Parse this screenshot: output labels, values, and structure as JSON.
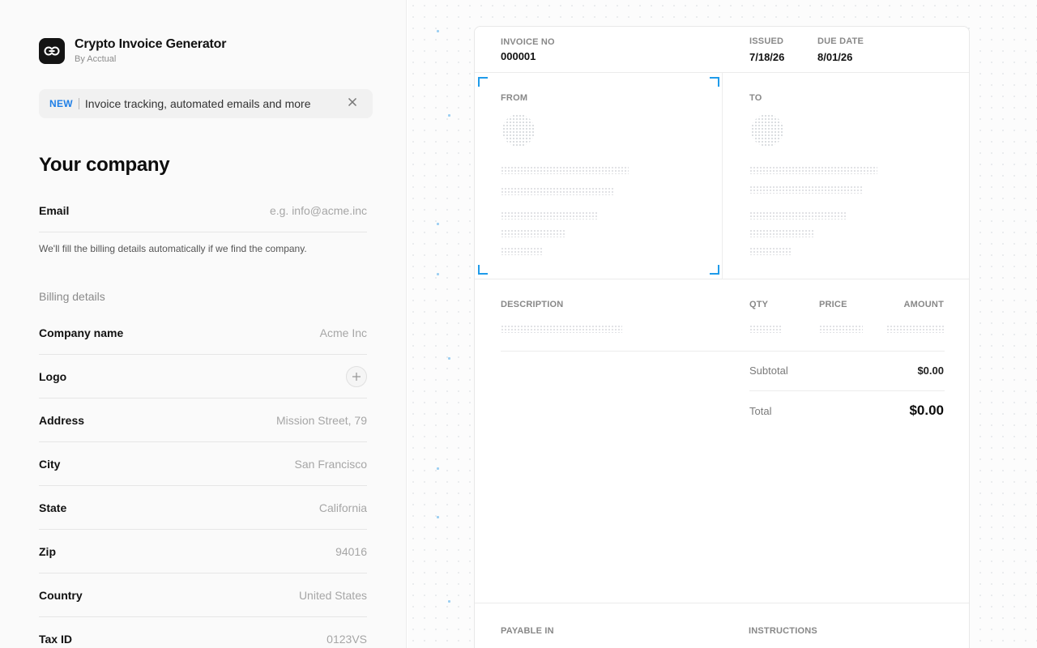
{
  "app": {
    "title": "Crypto Invoice Generator",
    "by": "By Acctual"
  },
  "promo": {
    "tag": "NEW",
    "text": "Invoice tracking, automated emails and more"
  },
  "company_section": {
    "title": "Your company",
    "email": {
      "label": "Email",
      "placeholder": "e.g. info@acme.inc",
      "value": ""
    },
    "hint": "We'll fill the billing details automatically if we find the company.",
    "billing_heading": "Billing details",
    "fields": {
      "company_name": {
        "label": "Company name",
        "placeholder": "Acme Inc"
      },
      "logo": {
        "label": "Logo"
      },
      "address": {
        "label": "Address",
        "placeholder": "Mission Street, 79"
      },
      "city": {
        "label": "City",
        "placeholder": "San Francisco"
      },
      "state": {
        "label": "State",
        "placeholder": "California"
      },
      "zip": {
        "label": "Zip",
        "placeholder": "94016"
      },
      "country": {
        "label": "Country",
        "placeholder": "United States"
      },
      "tax_id": {
        "label": "Tax ID",
        "placeholder": "0123VS"
      }
    }
  },
  "invoice": {
    "invoice_no_label": "INVOICE NO",
    "invoice_no": "000001",
    "issued_label": "ISSUED",
    "issued": "7/18/26",
    "due_label": "DUE DATE",
    "due": "8/01/26",
    "from_label": "FROM",
    "to_label": "TO",
    "columns": {
      "description": "DESCRIPTION",
      "qty": "QTY",
      "price": "PRICE",
      "amount": "AMOUNT"
    },
    "subtotal_label": "Subtotal",
    "subtotal": "$0.00",
    "total_label": "Total",
    "total": "$0.00",
    "payable_in_label": "PAYABLE IN",
    "instructions_label": "INSTRUCTIONS"
  },
  "colors": {
    "accent": "#1f7fe6",
    "selection_corner": "#1f9bea"
  },
  "icons": {
    "app": "link-chain-icon",
    "close": "close-icon",
    "add": "plus-icon"
  }
}
